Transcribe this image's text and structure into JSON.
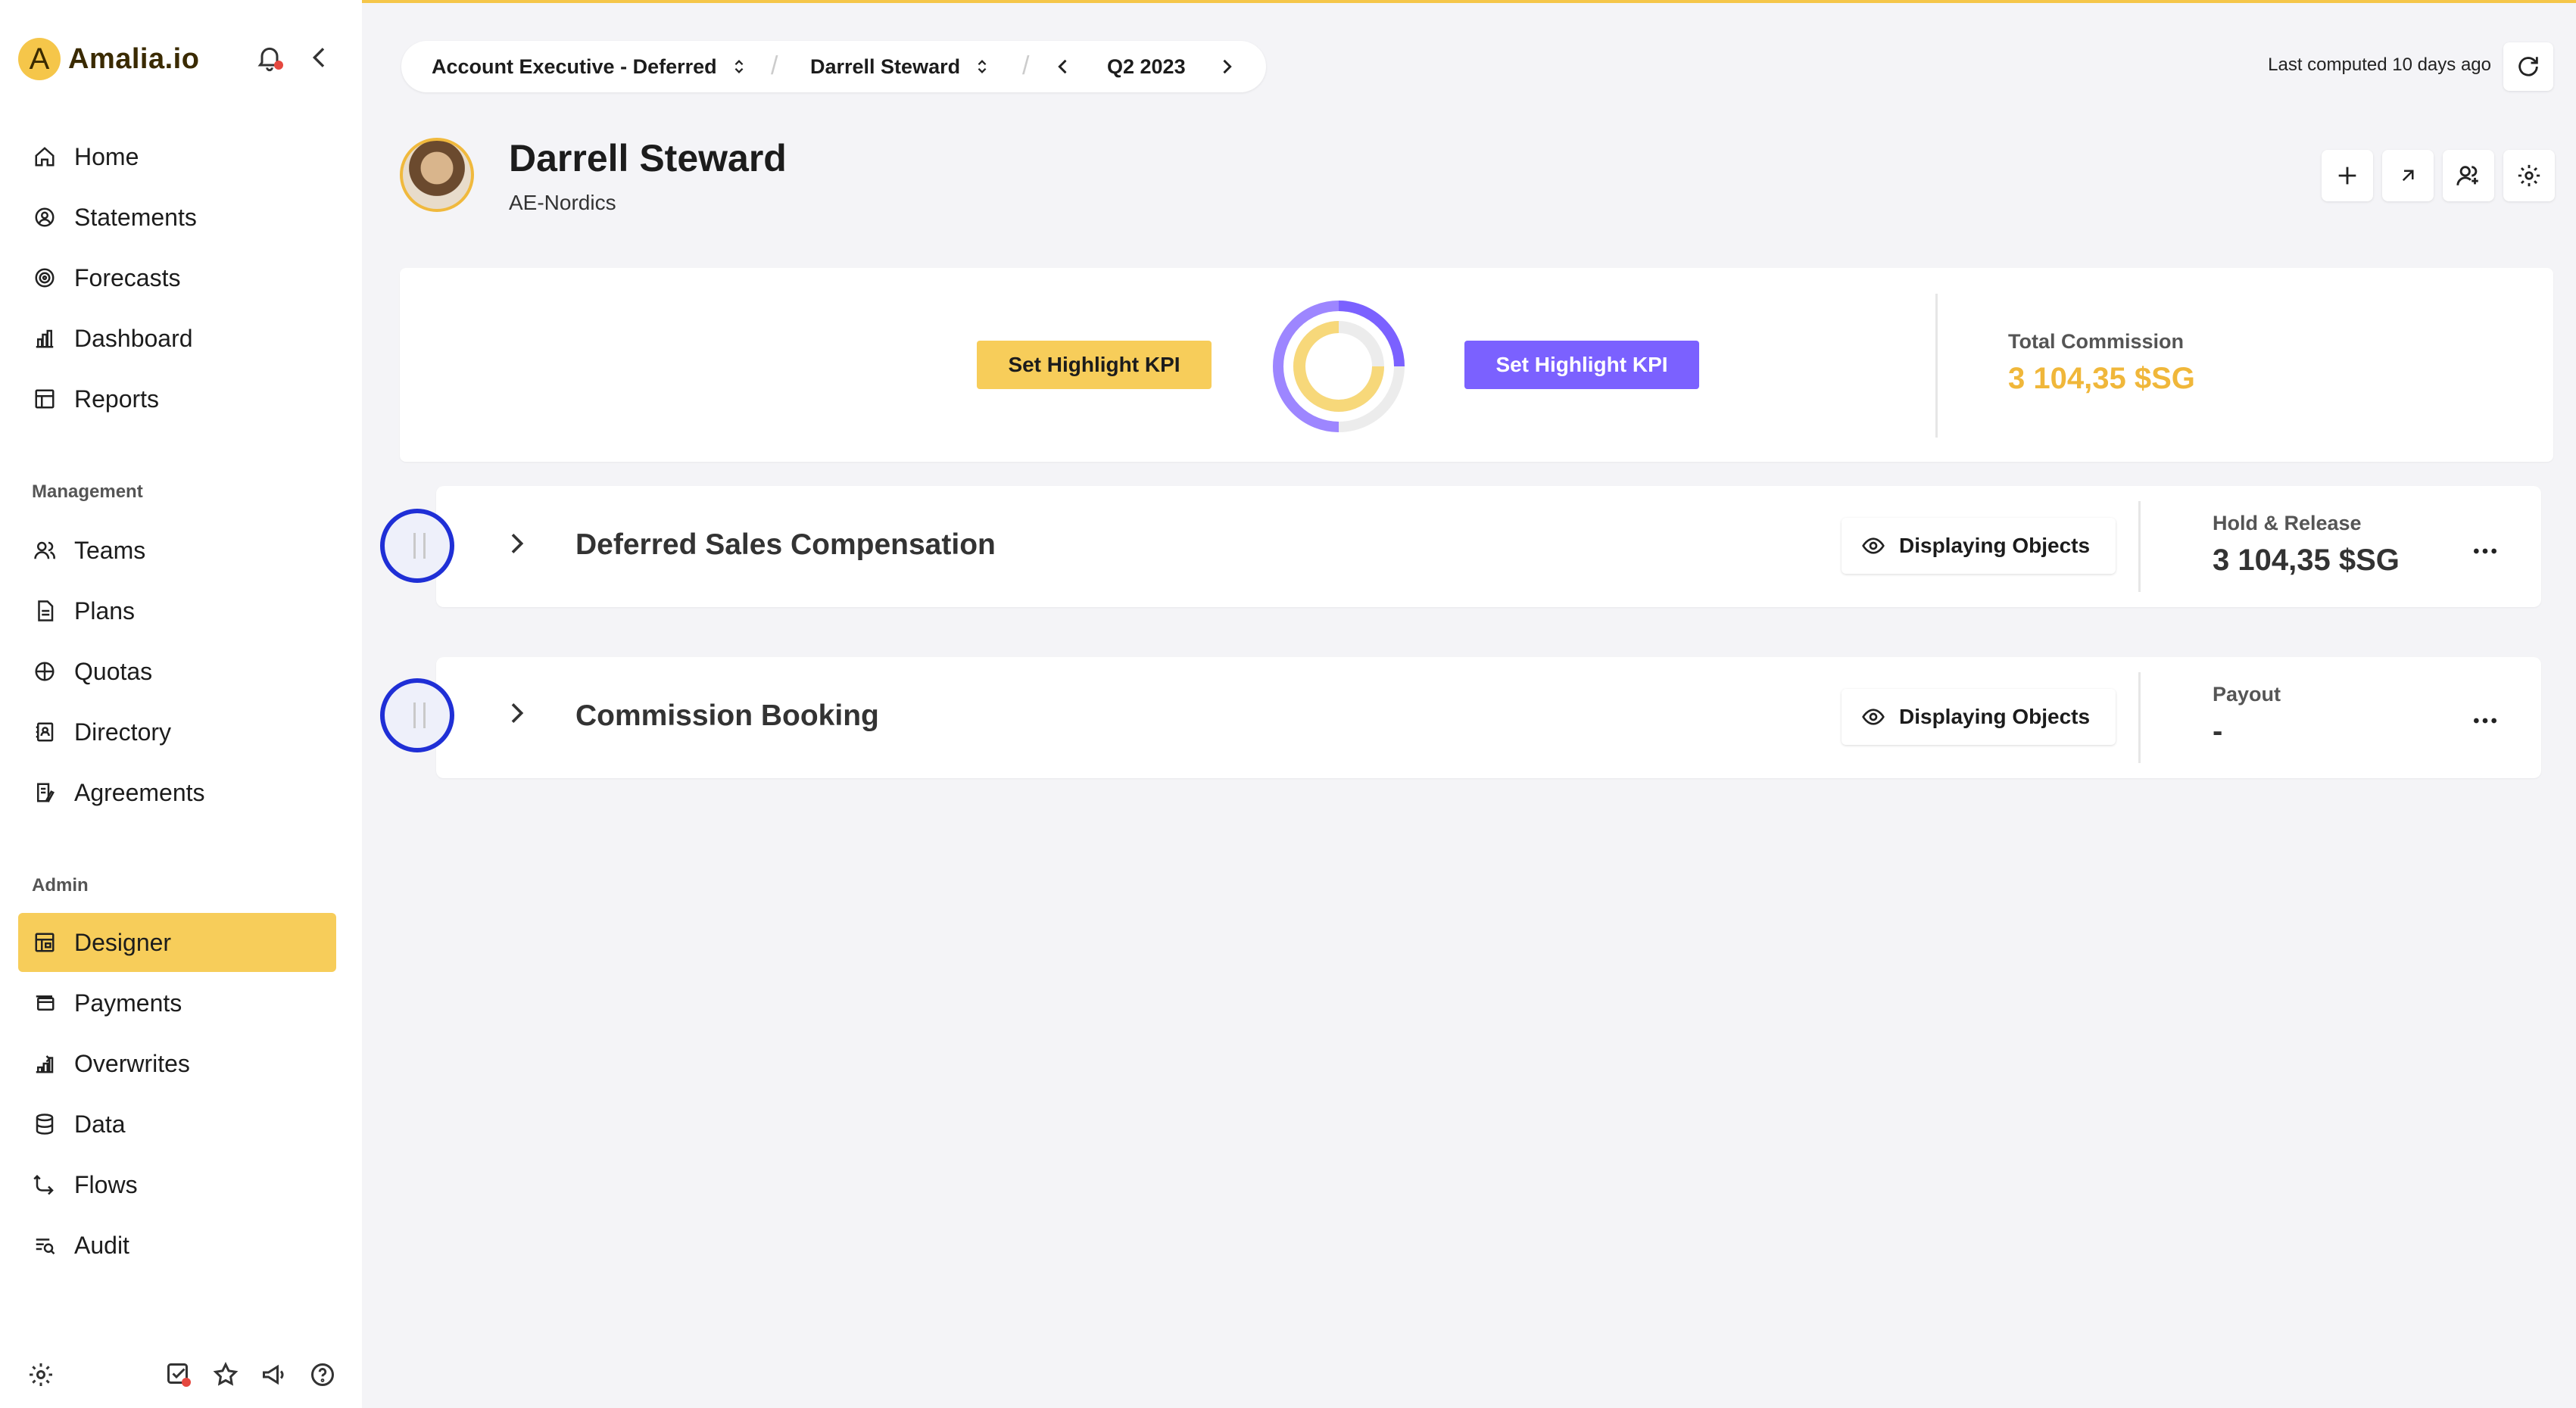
{
  "app": {
    "brand_letter": "A",
    "brand_name": "Amalia.io",
    "accent_color": "#f7cd5a",
    "purple_color": "#7b61ff"
  },
  "sidebar": {
    "main_items": [
      {
        "label": "Home",
        "icon": "home-icon"
      },
      {
        "label": "Statements",
        "icon": "statements-icon"
      },
      {
        "label": "Forecasts",
        "icon": "forecasts-icon"
      },
      {
        "label": "Dashboard",
        "icon": "dashboard-icon"
      },
      {
        "label": "Reports",
        "icon": "reports-icon"
      }
    ],
    "management_label": "Management",
    "management_items": [
      {
        "label": "Teams",
        "icon": "teams-icon"
      },
      {
        "label": "Plans",
        "icon": "plans-icon"
      },
      {
        "label": "Quotas",
        "icon": "quotas-icon"
      },
      {
        "label": "Directory",
        "icon": "directory-icon"
      },
      {
        "label": "Agreements",
        "icon": "agreements-icon"
      }
    ],
    "admin_label": "Admin",
    "admin_items": [
      {
        "label": "Designer",
        "icon": "designer-icon",
        "active": true
      },
      {
        "label": "Payments",
        "icon": "payments-icon"
      },
      {
        "label": "Overwrites",
        "icon": "overwrites-icon"
      },
      {
        "label": "Data",
        "icon": "data-icon"
      },
      {
        "label": "Flows",
        "icon": "flows-icon"
      },
      {
        "label": "Audit",
        "icon": "audit-icon"
      }
    ]
  },
  "topbar": {
    "plan_selector": "Account Executive - Deferred",
    "user_selector": "Darrell Steward",
    "period": "Q2 2023",
    "last_computed": "Last computed 10 days ago"
  },
  "header": {
    "name": "Darrell Steward",
    "team": "AE-Nordics"
  },
  "kpi": {
    "highlight_left": "Set Highlight KPI",
    "highlight_right": "Set Highlight KPI",
    "total_label": "Total Commission",
    "total_value": "3 104,35 $SG"
  },
  "rows": [
    {
      "name": "Deferred Sales Compensation",
      "display_label": "Displaying Objects",
      "label": "Hold & Release",
      "value": "3 104,35 $SG"
    },
    {
      "name": "Commission Booking",
      "display_label": "Displaying Objects",
      "label": "Payout",
      "value": "-"
    }
  ]
}
